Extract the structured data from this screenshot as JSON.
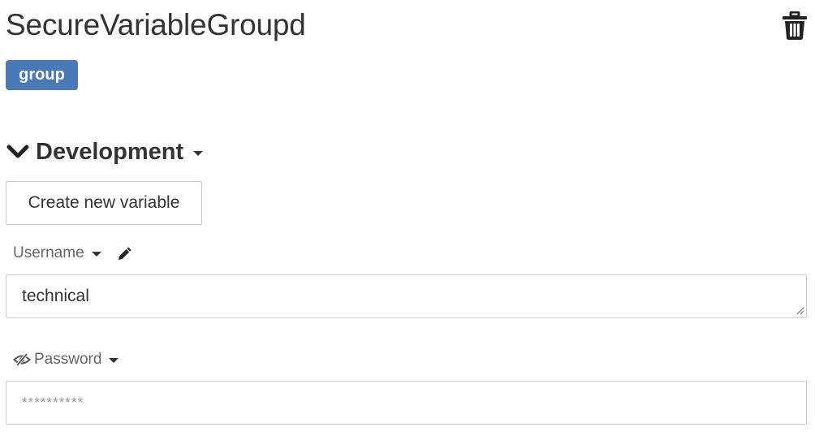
{
  "header": {
    "title": "SecureVariableGroupd",
    "delete_icon": "trash-icon",
    "badge": "group",
    "badge_color": "#4a79b7"
  },
  "section": {
    "title": "Development",
    "toggle_icon": "chevron-down-icon",
    "menu_icon": "caret-down-icon",
    "create_button_label": "Create new variable"
  },
  "variables": [
    {
      "name": "Username",
      "menu_icon": "caret-down-icon",
      "edit_icon": "pencil-icon",
      "value": "technical"
    },
    {
      "name": "Password",
      "visibility_icon": "eye-slash-icon",
      "menu_icon": "caret-down-icon",
      "placeholder": "**********"
    }
  ]
}
